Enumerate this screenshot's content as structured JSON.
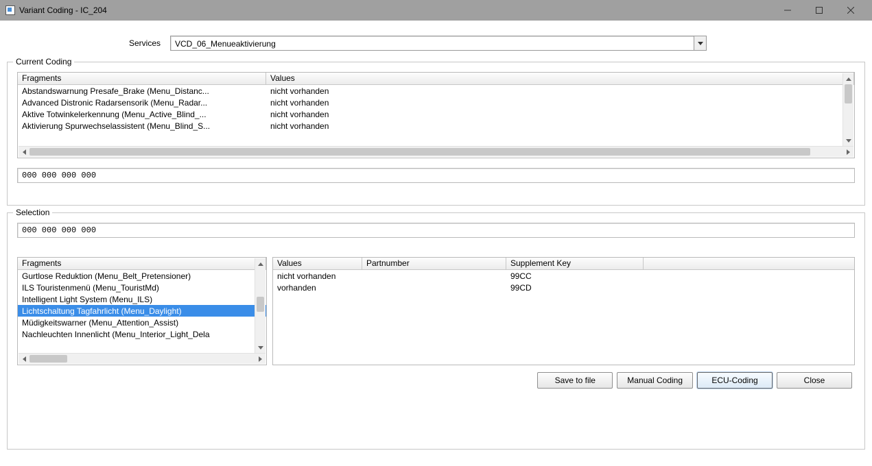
{
  "window": {
    "title": "Variant Coding - IC_204"
  },
  "services": {
    "label": "Services",
    "selected": "VCD_06_Menueaktivierung"
  },
  "current_coding": {
    "legend": "Current Coding",
    "columns": {
      "fragments": "Fragments",
      "values": "Values"
    },
    "rows": [
      {
        "fragment": "Abstandswarnung Presafe_Brake (Menu_Distanc...",
        "value": "nicht vorhanden"
      },
      {
        "fragment": "Advanced Distronic Radarsensorik (Menu_Radar...",
        "value": "nicht vorhanden"
      },
      {
        "fragment": "Aktive Totwinkelerkennung (Menu_Active_Blind_...",
        "value": "nicht vorhanden"
      },
      {
        "fragment": "Aktivierung Spurwechselassistent (Menu_Blind_S...",
        "value": "nicht vorhanden"
      }
    ],
    "hex": "000 000 000 000"
  },
  "selection": {
    "legend": "Selection",
    "hex": "000 000 000 000",
    "fragments": {
      "header": "Fragments",
      "items": [
        "Gurtlose Reduktion (Menu_Belt_Pretensioner)",
        "ILS Touristenmenü (Menu_TouristMd)",
        "Intelligent Light System (Menu_ILS)",
        "Lichtschaltung Tagfahrlicht (Menu_Daylight)",
        "Müdigkeitswarner (Menu_Attention_Assist)",
        "Nachleuchten Innenlicht (Menu_Interior_Light_Dela"
      ],
      "selected_index": 3
    },
    "value_table": {
      "columns": {
        "values": "Values",
        "partnumber": "Partnumber",
        "supplement": "Supplement Key"
      },
      "rows": [
        {
          "value": "nicht vorhanden",
          "partnumber": "",
          "supplement": "99CC"
        },
        {
          "value": "vorhanden",
          "partnumber": "",
          "supplement": "99CD"
        }
      ]
    }
  },
  "buttons": {
    "save": "Save to file",
    "manual": "Manual Coding",
    "ecu": "ECU-Coding",
    "close": "Close"
  }
}
